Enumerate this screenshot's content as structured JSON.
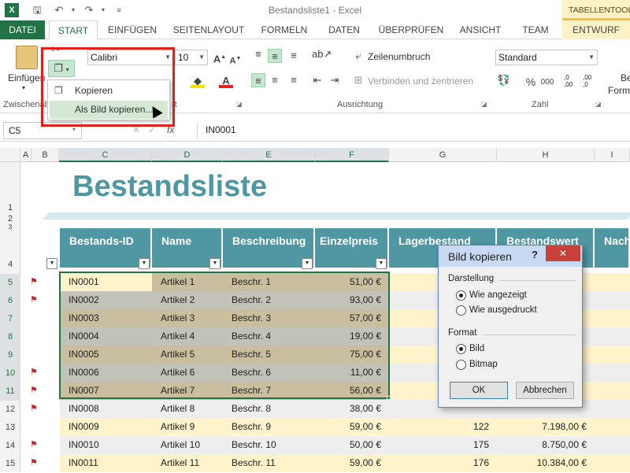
{
  "window": {
    "title": "Bestandsliste1 - Excel",
    "tools_tab": "TABELLENTOOLS"
  },
  "tabs": [
    "DATEI",
    "START",
    "EINFÜGEN",
    "SEITENLAYOUT",
    "FORMELN",
    "DATEN",
    "ÜBERPRÜFEN",
    "ANSICHT",
    "TEAM",
    "ENTWURF"
  ],
  "ribbon": {
    "paste_label": "Einfügen",
    "clipboard_group": "Zwischenab",
    "font_name": "Calibri",
    "font_size": "10",
    "font_group_tail": "rt",
    "wrap_text": "Zeilenumbruch",
    "merge_center": "Verbinden und zentrieren",
    "alignment_group": "Ausrichtung",
    "number_format": "Standard",
    "number_group": "Zahl",
    "percent": "%",
    "thousands": "000",
    "dec_inc": ",0\n,00",
    "dec_dec": ",00\n,0",
    "right_cut_1": "Be",
    "right_cut_2": "Form"
  },
  "copy_menu": {
    "copy": "Kopieren",
    "copy_as_picture": "Als Bild kopieren..."
  },
  "formula_bar": {
    "name_box": "C5",
    "value": "IN0001",
    "fx": "fx"
  },
  "columns": [
    "A",
    "B",
    "C",
    "D",
    "E",
    "F",
    "G",
    "H",
    "I"
  ],
  "rows": [
    "1",
    "2",
    "3",
    "4",
    "5",
    "6",
    "7",
    "8",
    "9",
    "10",
    "11",
    "12",
    "13",
    "14",
    "15"
  ],
  "sheet": {
    "title": "Bestandsliste",
    "headers": [
      "Bestands-ID",
      "Name",
      "Beschreibung",
      "Einzelpreis",
      "Lagerbestand",
      "Bestandswert",
      "Nach"
    ],
    "data": [
      [
        "IN0001",
        "Artikel 1",
        "Beschr. 1",
        "51,00 €",
        "",
        ""
      ],
      [
        "IN0002",
        "Artikel 2",
        "Beschr. 2",
        "93,00 €",
        "",
        ""
      ],
      [
        "IN0003",
        "Artikel 3",
        "Beschr. 3",
        "57,00 €",
        "",
        ""
      ],
      [
        "IN0004",
        "Artikel 4",
        "Beschr. 4",
        "19,00 €",
        "",
        ""
      ],
      [
        "IN0005",
        "Artikel 5",
        "Beschr. 5",
        "75,00 €",
        "",
        ""
      ],
      [
        "IN0006",
        "Artikel 6",
        "Beschr. 6",
        "11,00 €",
        "",
        ""
      ],
      [
        "IN0007",
        "Artikel 7",
        "Beschr. 7",
        "56,00 €",
        "",
        ""
      ],
      [
        "IN0008",
        "Artikel 8",
        "Beschr. 8",
        "38,00 €",
        "",
        ""
      ],
      [
        "IN0009",
        "Artikel 9",
        "Beschr. 9",
        "59,00 €",
        "122",
        "7.198,00 €"
      ],
      [
        "IN0010",
        "Artikel 10",
        "Beschr. 10",
        "50,00 €",
        "175",
        "8.750,00 €"
      ],
      [
        "IN0011",
        "Artikel 11",
        "Beschr. 11",
        "59,00 €",
        "176",
        "10.384,00 €"
      ]
    ]
  },
  "dialog": {
    "title": "Bild kopieren",
    "help": "?",
    "close": "✕",
    "appearance_label": "Darstellung",
    "as_shown": "Wie angezeigt",
    "as_printed": "Wie ausgedruckt",
    "format_label": "Format",
    "picture": "Bild",
    "bitmap": "Bitmap",
    "ok": "OK",
    "cancel": "Abbrechen"
  },
  "colors": {
    "excel_green": "#217346",
    "table_header": "#4f98a3",
    "title_teal": "#4f98a3",
    "selection": "#c9bf9e",
    "row_stripe_a": "#fff3cc",
    "row_stripe_b": "#eeeeef",
    "highlight_red": "#e3201b"
  }
}
